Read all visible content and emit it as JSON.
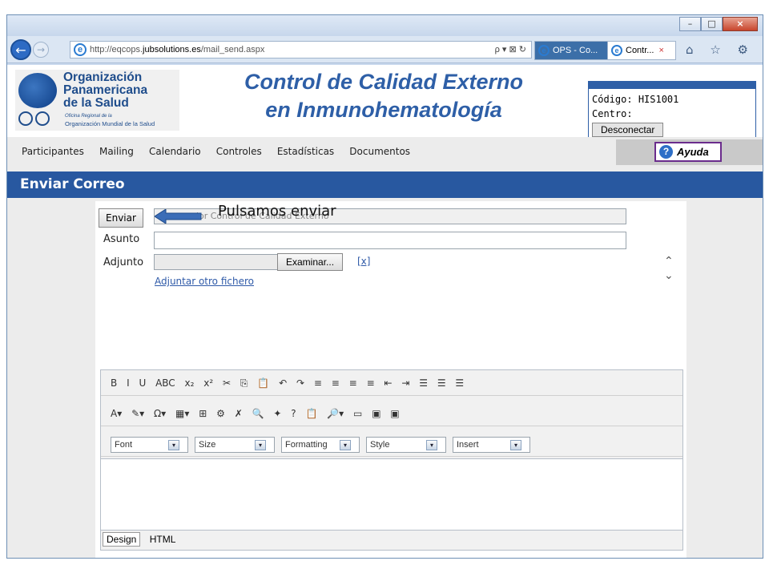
{
  "browser": {
    "address_prefix": "http://eqcops.",
    "address_domain": "jubsolutions.es",
    "address_path": "/mail_send.aspx",
    "addr_tools": "ρ ▾ ⊠ ↻",
    "tab1_label": "OPS - Co...",
    "tab2_label": "Contr...",
    "tab2_close": "×",
    "minimize": "–",
    "maximize": "□",
    "close": "×",
    "back_glyph": "←",
    "forward_glyph": "→",
    "ie_glyph": "e",
    "toolbar_icons": "⌂ ☆ ⚙"
  },
  "header": {
    "logo_line1": "Organización",
    "logo_line2": "Panamericana",
    "logo_line3": "de la Salud",
    "logo_sub1": "Oficina Regional de la",
    "logo_sub2": "Organización Mundial de la Salud",
    "title_line1": "Control de Calidad Externo",
    "title_line2": "en Inmunohematología",
    "codigo_label": "Código:",
    "codigo_value": "HIS1001",
    "centro_label": "Centro:",
    "disconnect": "Desconectar"
  },
  "menu": {
    "items": [
      "Participantes",
      "Mailing",
      "Calendario",
      "Controles",
      "Estadísticas",
      "Documentos"
    ],
    "help": "Ayuda",
    "help_glyph": "?"
  },
  "section_title": "Enviar Correo",
  "form": {
    "send_button": "Enviar",
    "from_value": "dor Control de Calidad Externo",
    "subject_label": "Asunto",
    "subject_value": "",
    "attachment_label": "Adjunto",
    "browse_button": "Examinar...",
    "remove_link": "[x]",
    "add_file_link": "Adjuntar otro fichero",
    "scroll_up": "⌃",
    "scroll_down": "⌄"
  },
  "annotation": "Pulsamos enviar",
  "editor": {
    "toolbar_row1": [
      "B",
      "I",
      "U",
      "ABC",
      "x₂",
      "x²",
      "✂",
      "⎘",
      "📋",
      "↶",
      "↷",
      "≡",
      "≡",
      "≡",
      "≡",
      "⇤",
      "⇥",
      "☰",
      "☰",
      "☰"
    ],
    "toolbar_row2": [
      "A▾",
      "✎▾",
      "Ω▾",
      "▦▾",
      "⊞",
      "⚙",
      "✗",
      "🔍",
      "✦",
      "?",
      "📋",
      "🔎▾",
      "▭",
      "▣",
      "▣"
    ],
    "dropdowns": [
      "Font",
      "Size",
      "Formatting",
      "Style",
      "Insert"
    ],
    "dropdown_chev": "▾",
    "mode_design": "Design",
    "mode_html": "HTML"
  }
}
